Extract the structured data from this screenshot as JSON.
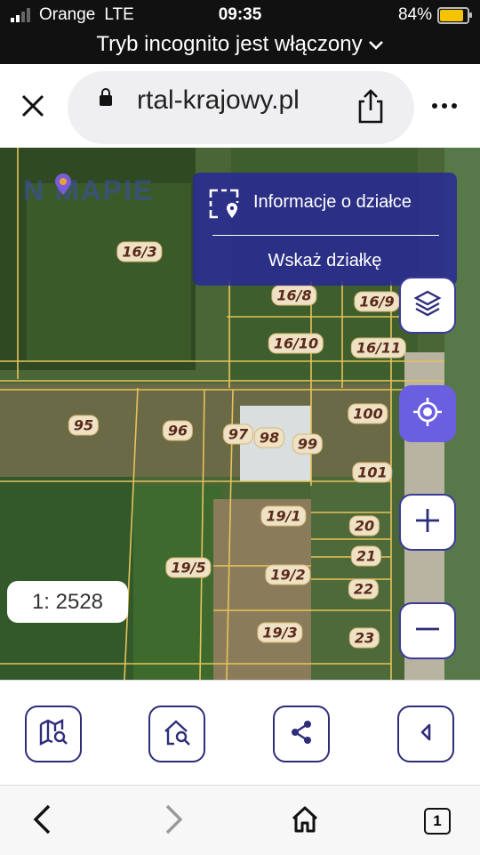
{
  "status_bar": {
    "carrier": "Orange",
    "network": "LTE",
    "time": "09:35",
    "battery": "84%",
    "battery_level": 0.84
  },
  "incognito_banner": "Tryb incognito jest włączony",
  "browser": {
    "url_display": "rtal-krajowy.pl"
  },
  "map": {
    "logo_text": "N  MAPIE",
    "parcels": [
      "16/3",
      "16/8",
      "16/9",
      "16/10",
      "16/11",
      "95",
      "96",
      "97",
      "98",
      "99",
      "100",
      "101",
      "19/1",
      "20",
      "21",
      "22",
      "19/5",
      "19/2",
      "19/3",
      "23"
    ],
    "info_panel": {
      "title": "Informacje o działce",
      "action": "Wskaż działkę"
    },
    "scale": "1: 2528",
    "accent_color": "#6a5fe0",
    "panel_color": "#28289a"
  },
  "toolbar": {
    "buttons": [
      "map-search",
      "home-search",
      "share",
      "collapse"
    ]
  },
  "browser_nav": {
    "tab_count": "1"
  }
}
